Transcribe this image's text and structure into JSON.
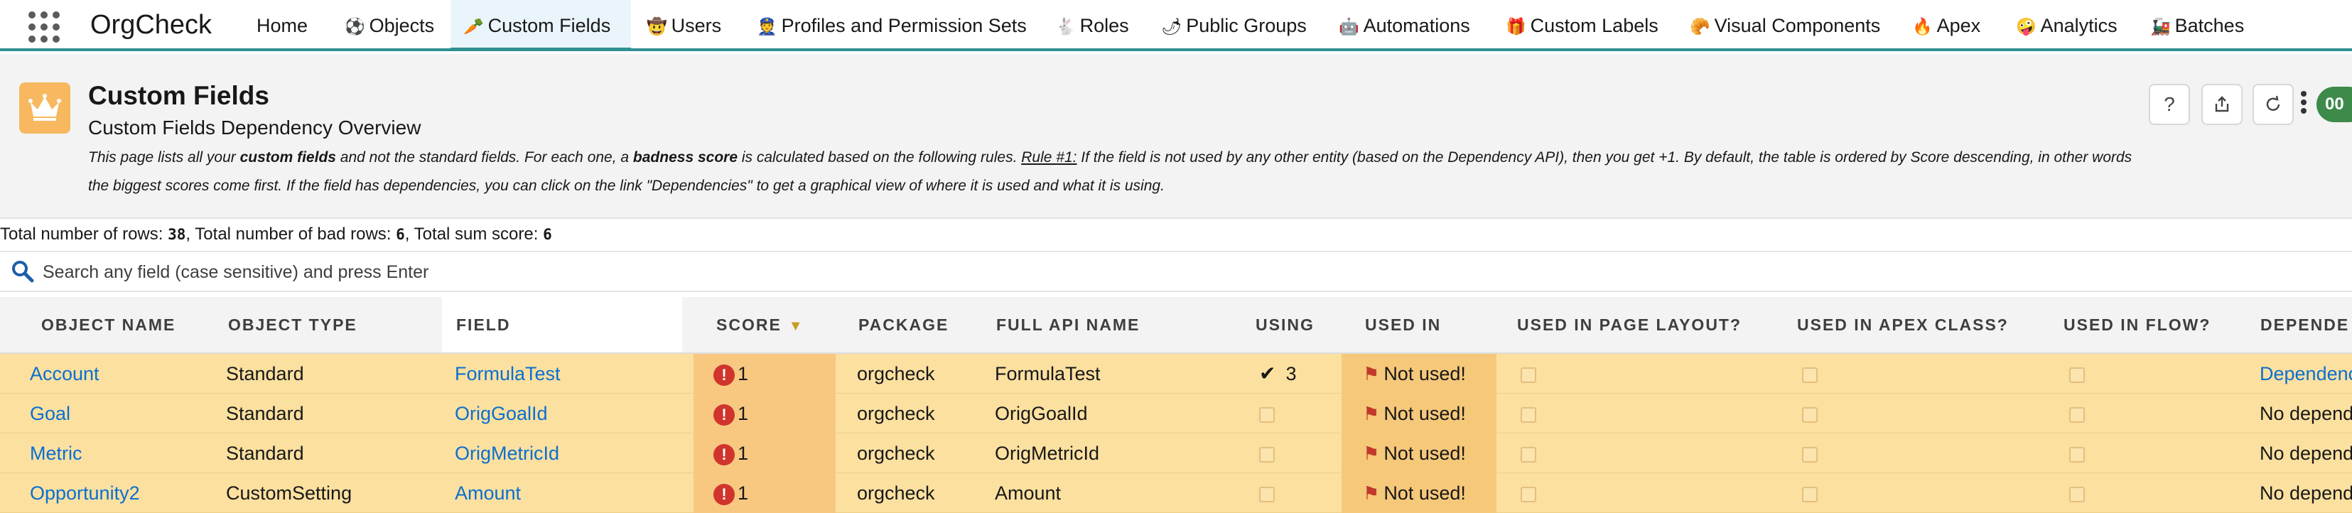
{
  "app": {
    "title": "OrgCheck"
  },
  "nav": {
    "items": [
      {
        "icon": "",
        "label": "Home"
      },
      {
        "icon": "⚽",
        "label": "Objects"
      },
      {
        "icon": "🥕",
        "label": "Custom Fields"
      },
      {
        "icon": "🤠",
        "label": "Users"
      },
      {
        "icon": "👮",
        "label": "Profiles and Permission Sets"
      },
      {
        "icon": "🐇",
        "label": "Roles"
      },
      {
        "icon": "🌶",
        "label": "Public Groups"
      },
      {
        "icon": "🤖",
        "label": "Automations"
      },
      {
        "icon": "🎁",
        "label": "Custom Labels"
      },
      {
        "icon": "🥐",
        "label": "Visual Components"
      },
      {
        "icon": "🔥",
        "label": "Apex"
      },
      {
        "icon": "🤪",
        "label": "Analytics"
      },
      {
        "icon": "🚂",
        "label": "Batches"
      }
    ],
    "active_index": 2
  },
  "header": {
    "title": "Custom Fields",
    "subtitle": "Custom Fields Dependency Overview",
    "desc": {
      "p1": "This page lists all your ",
      "b1": "custom fields",
      "p2": " and not the standard fields. For each one, a ",
      "b2": "badness score",
      "p3": " is calculated based on the following rules. ",
      "rule": "Rule #1:",
      "p4": " If the field is not used by any other entity (based on the Dependency API), then you get +1. By default, the table is ordered by Score descending, in other words the biggest scores come first. If the field has dependencies, you can click on the link \"Dependencies\" to get a graphical view of where it is used and what it is using."
    },
    "avatar_text": "00"
  },
  "stats": {
    "rows_label": "Total number of rows: ",
    "rows_value": "38",
    "bad_label": ", Total number of bad rows: ",
    "bad_value": "6",
    "sum_label": ", Total sum score: ",
    "sum_value": "6"
  },
  "search": {
    "placeholder": "Search any field (case sensitive) and press Enter"
  },
  "table": {
    "columns": [
      "OBJECT NAME",
      "OBJECT TYPE",
      "FIELD",
      "SCORE",
      "PACKAGE",
      "FULL API NAME",
      "USING",
      "USED IN",
      "USED IN PAGE LAYOUT?",
      "USED IN APEX CLASS?",
      "USED IN FLOW?",
      "DEPENDE"
    ],
    "rows": [
      {
        "object_name": "Account",
        "object_type": "Standard",
        "field": "FormulaTest",
        "score": "1",
        "package": "orgcheck",
        "api_name": "FormulaTest",
        "using": "3",
        "used_in": "Not used!",
        "dependencies": "Dependencies"
      },
      {
        "object_name": "Goal",
        "object_type": "Standard",
        "field": "OrigGoalId",
        "score": "1",
        "package": "orgcheck",
        "api_name": "OrigGoalId",
        "using": "",
        "used_in": "Not used!",
        "dependencies": "No depend"
      },
      {
        "object_name": "Metric",
        "object_type": "Standard",
        "field": "OrigMetricId",
        "score": "1",
        "package": "orgcheck",
        "api_name": "OrigMetricId",
        "using": "",
        "used_in": "Not used!",
        "dependencies": "No depend"
      },
      {
        "object_name": "Opportunity2",
        "object_type": "CustomSetting",
        "field": "Amount",
        "score": "1",
        "package": "orgcheck",
        "api_name": "Amount",
        "using": "",
        "used_in": "Not used!",
        "dependencies": "No depend"
      }
    ]
  },
  "colors": {
    "accent": "#2f8f91",
    "row_bg": "#fbe0a0",
    "score_bg": "#f8c880",
    "link": "#0b6fd0",
    "badge": "#d0342c"
  }
}
